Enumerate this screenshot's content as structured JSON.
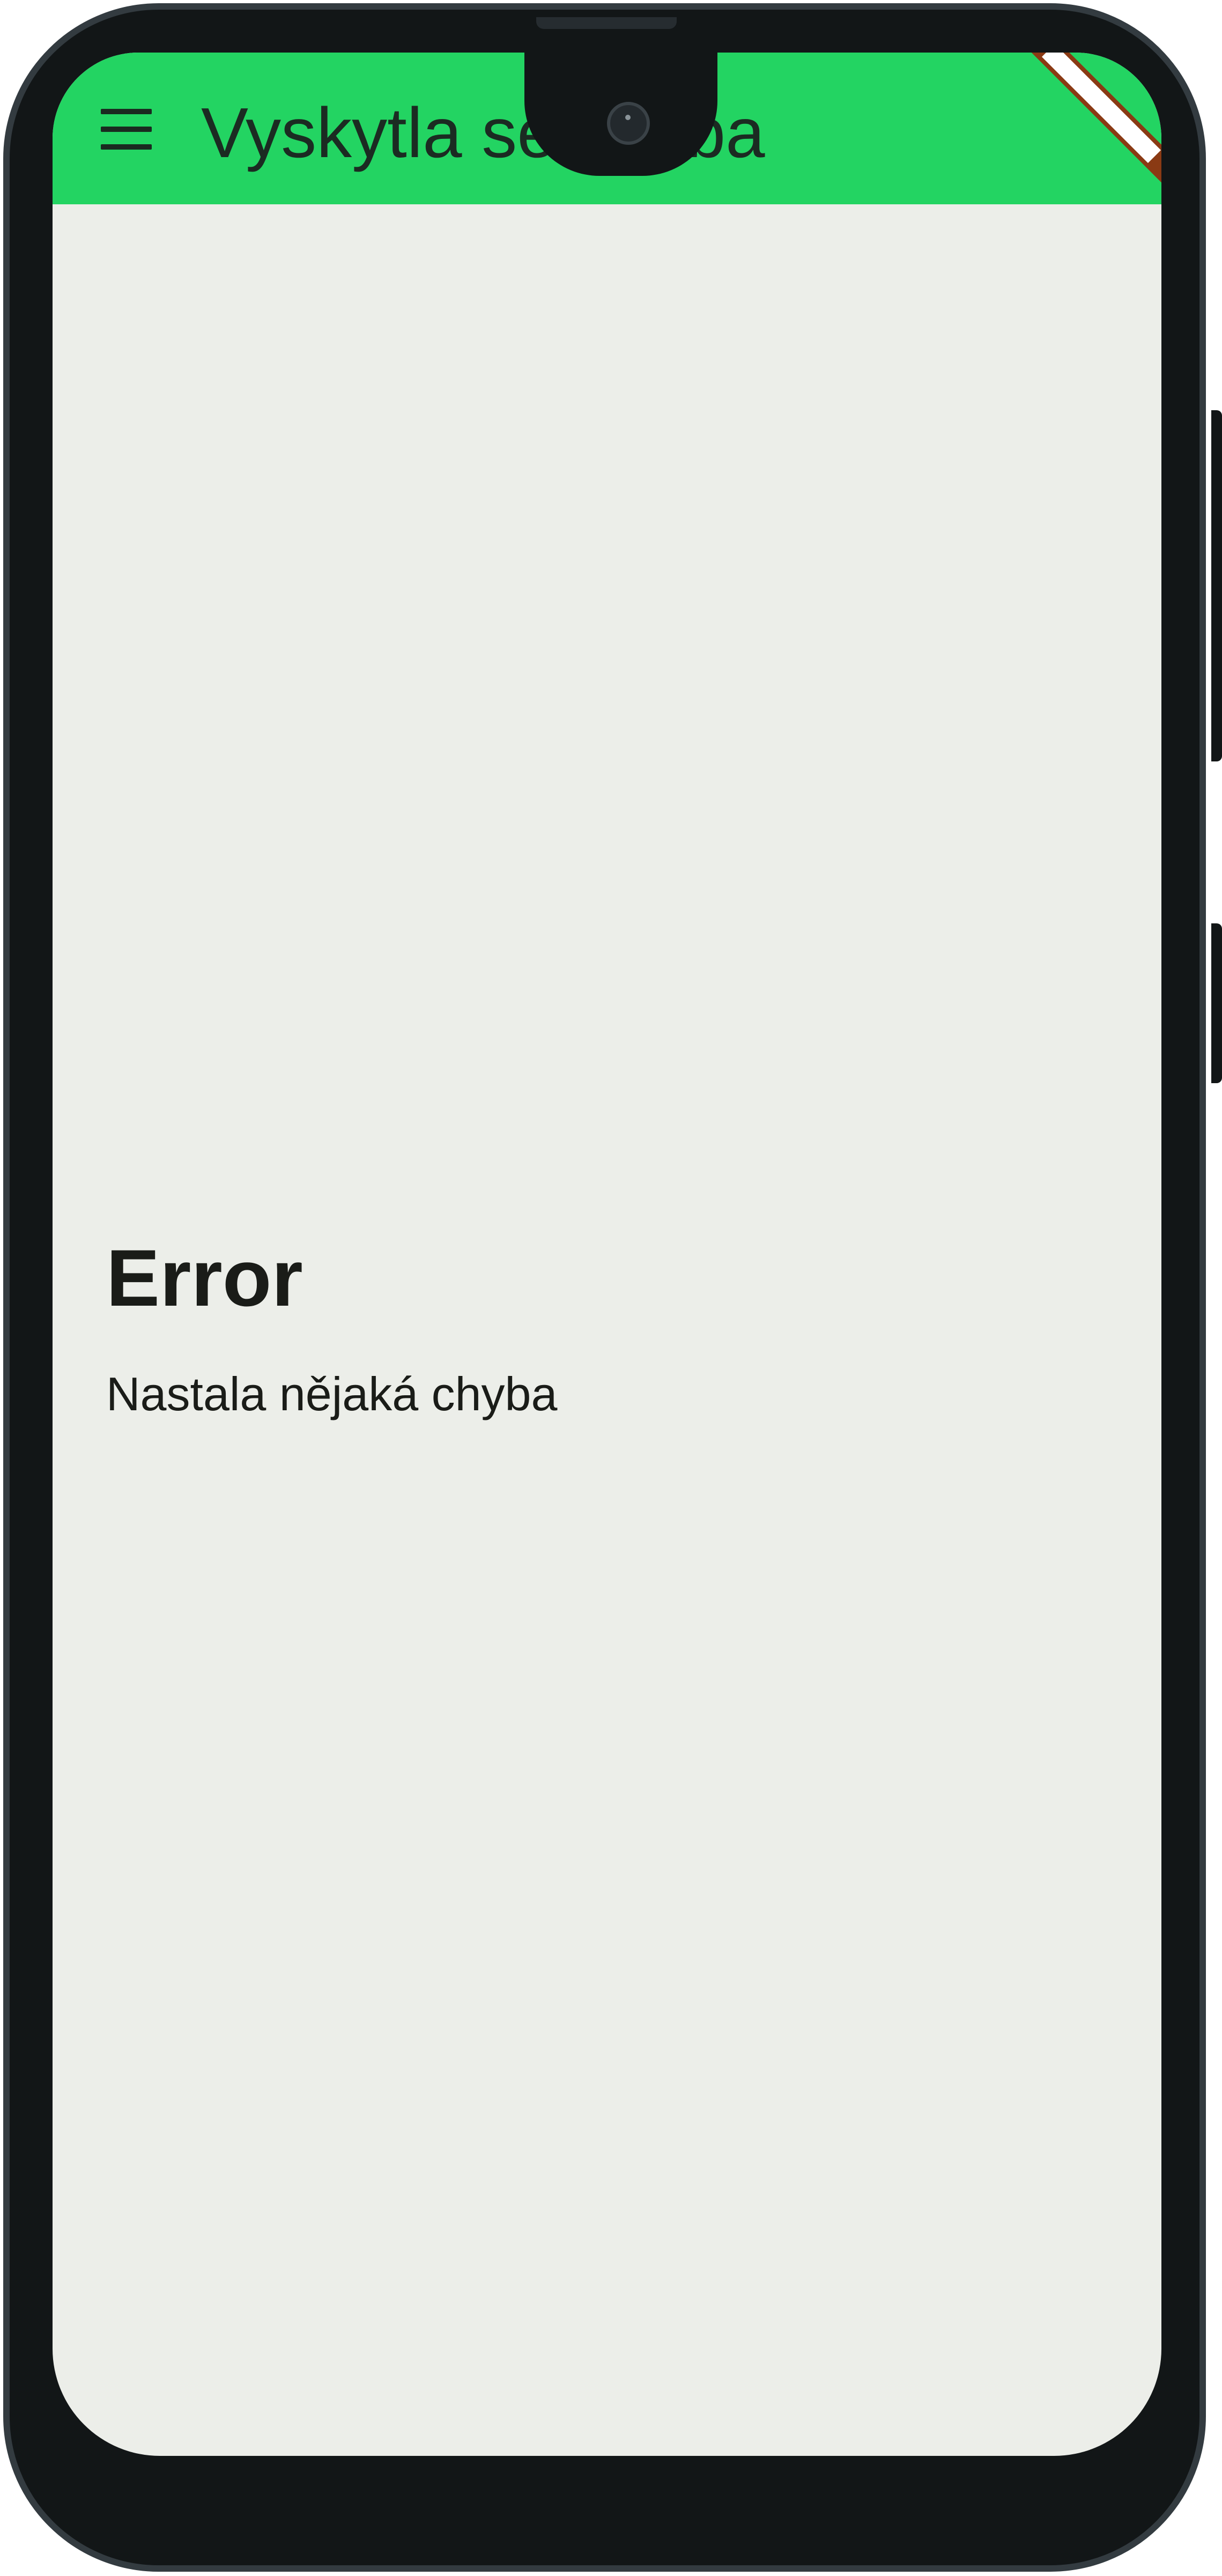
{
  "app_bar": {
    "title": "Vyskytla se chyba",
    "menu_icon": "menu-icon",
    "background": "#23d462"
  },
  "error": {
    "heading": "Error",
    "message": "Nastala nějaká chyba"
  },
  "debug_banner": {
    "color": "#8a3a14"
  },
  "device": {
    "frame_color": "#121617",
    "screen_background": "#eceee9"
  }
}
